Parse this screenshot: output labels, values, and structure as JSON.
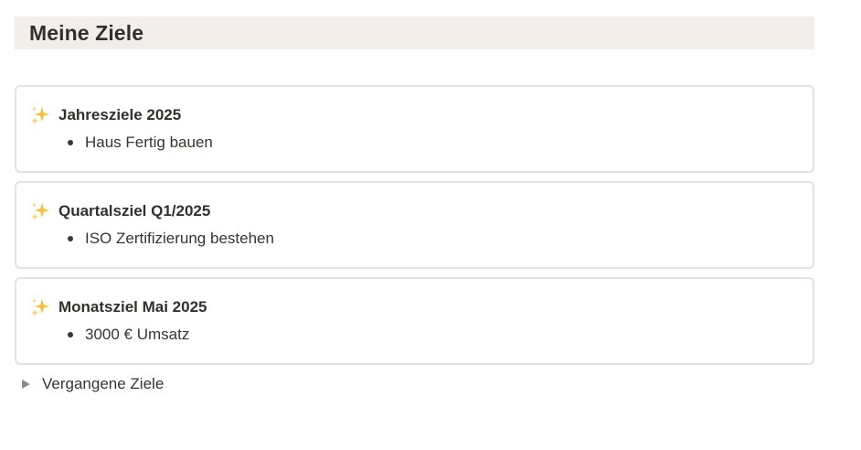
{
  "heading": {
    "title": "Meine Ziele",
    "background": "#f4eeeb"
  },
  "callouts": [
    {
      "icon": "sparkles-icon",
      "title": "Jahresziele 2025",
      "items": [
        "Haus Fertig bauen"
      ]
    },
    {
      "icon": "sparkles-icon",
      "title": "Quartalsziel Q1/2025",
      "items": [
        "ISO Zertifizierung bestehen"
      ]
    },
    {
      "icon": "sparkles-icon",
      "title": "Monatsziel Mai 2025",
      "items": [
        "3000 € Umsatz"
      ]
    }
  ],
  "toggle": {
    "label": "Vergangene Ziele",
    "expanded": false
  },
  "colors": {
    "text": "#37352f",
    "border": "#e3e2e0",
    "sparkle": "#f2c037"
  }
}
